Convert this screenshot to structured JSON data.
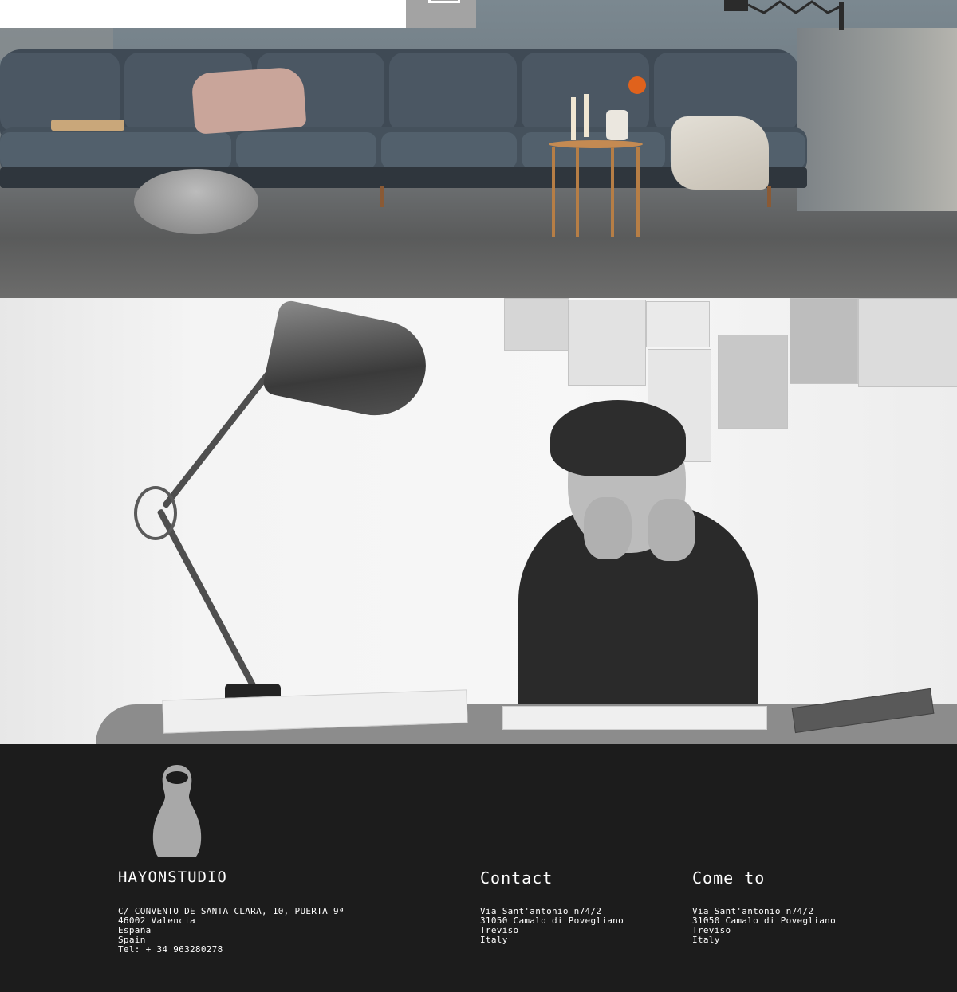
{
  "search": {
    "value": "",
    "placeholder": ""
  },
  "footer": {
    "brand": "HAYONSTUDIO",
    "studio_address": [
      "C/ CONVENTO DE SANTA CLARA, 10, PUERTA 9ª",
      "46002 Valencia",
      "España",
      "Spain",
      "Tel: + 34 963280278"
    ],
    "contact": {
      "title": "Contact",
      "lines": [
        "Via Sant'antonio n74/2",
        "31050 Camalo di Povegliano",
        "Treviso",
        "Italy"
      ]
    },
    "come_to": {
      "title": "Come to",
      "lines": [
        "Via Sant'antonio n74/2",
        "31050 Camalo di Povegliano",
        "Treviso",
        "Italy"
      ]
    }
  },
  "colors": {
    "footer_bg": "#1c1c1c",
    "search_button_bg": "#a3a3a3",
    "logo_fill": "#a8a8a8"
  },
  "icons": {
    "search_button": "search-button-glyph",
    "logo": "matryoshka-logo-icon"
  }
}
